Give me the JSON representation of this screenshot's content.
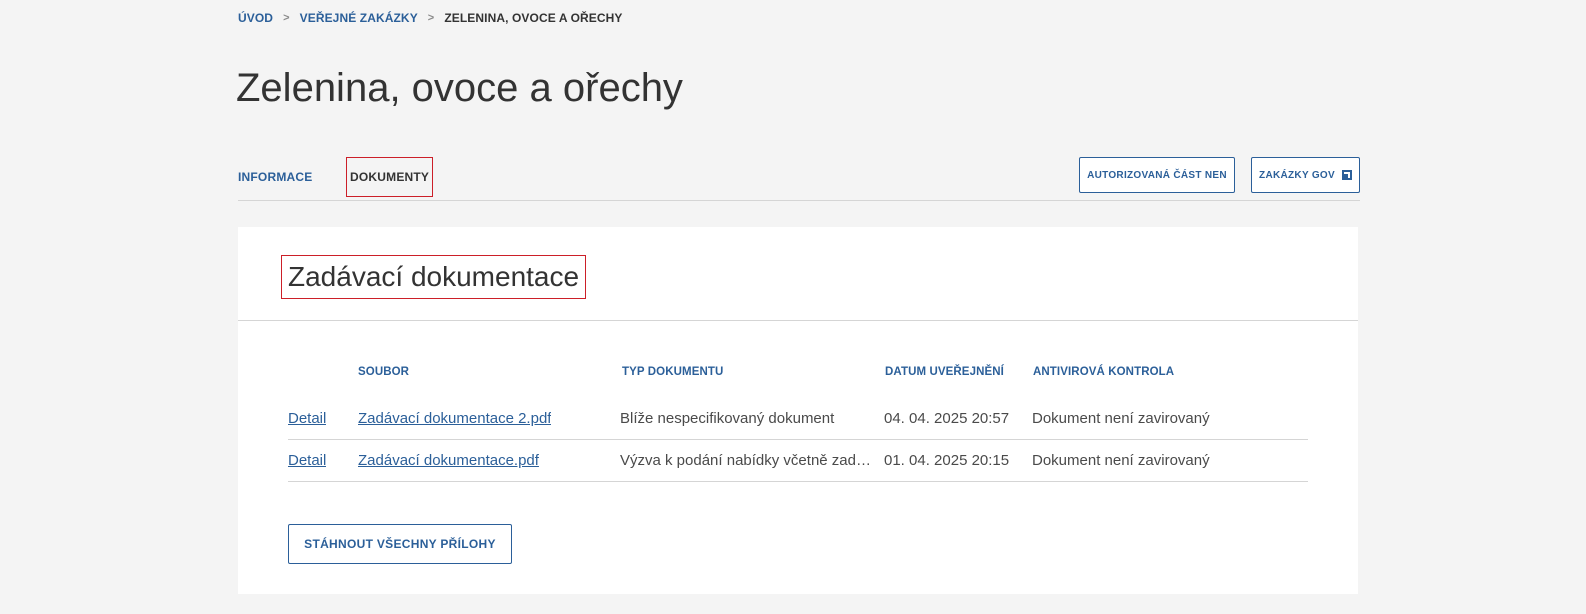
{
  "breadcrumb": {
    "items": [
      "ÚVOD",
      "VEŘEJNÉ ZAKÁZKY"
    ],
    "separator": ">",
    "current": "ZELENINA, OVOCE A OŘECHY"
  },
  "page": {
    "title": "Zelenina, ovoce a ořechy"
  },
  "tabs": [
    {
      "label": "INFORMACE",
      "active": false
    },
    {
      "label": "DOKUMENTY",
      "active": true
    }
  ],
  "actions": {
    "nen_label": "AUTORIZOVANÁ ČÁST NEN",
    "gov_label": "ZAKÁZKY GOV",
    "gov_icon": "external-link-icon"
  },
  "documents": {
    "title": "Zadávací dokumentace",
    "headers": {
      "file": "SOUBOR",
      "type": "TYP DOKUMENTU",
      "date": "DATUM UVEŘEJNĚNÍ",
      "antivirus": "ANTIVIROVÁ KONTROLA"
    },
    "rows": [
      {
        "detail": "Detail",
        "file": "Zadávací dokumentace 2.pdf",
        "type": "Blíže nespecifikovaný dokument",
        "date": "04. 04. 2025 20:57",
        "antivirus": "Dokument není zavirovaný"
      },
      {
        "detail": "Detail",
        "file": "Zadávací dokumentace.pdf",
        "type": "Výzva k podání nabídky včetně zadávací dokumentace",
        "date": "01. 04. 2025 20:15",
        "antivirus": "Dokument není zavirovaný"
      }
    ],
    "download_all_label": "STÁHNOUT VŠECHNY PŘÍLOHY"
  },
  "colors": {
    "accent": "#2b5f99",
    "highlight": "#cc1f28",
    "background": "#f4f4f4"
  }
}
